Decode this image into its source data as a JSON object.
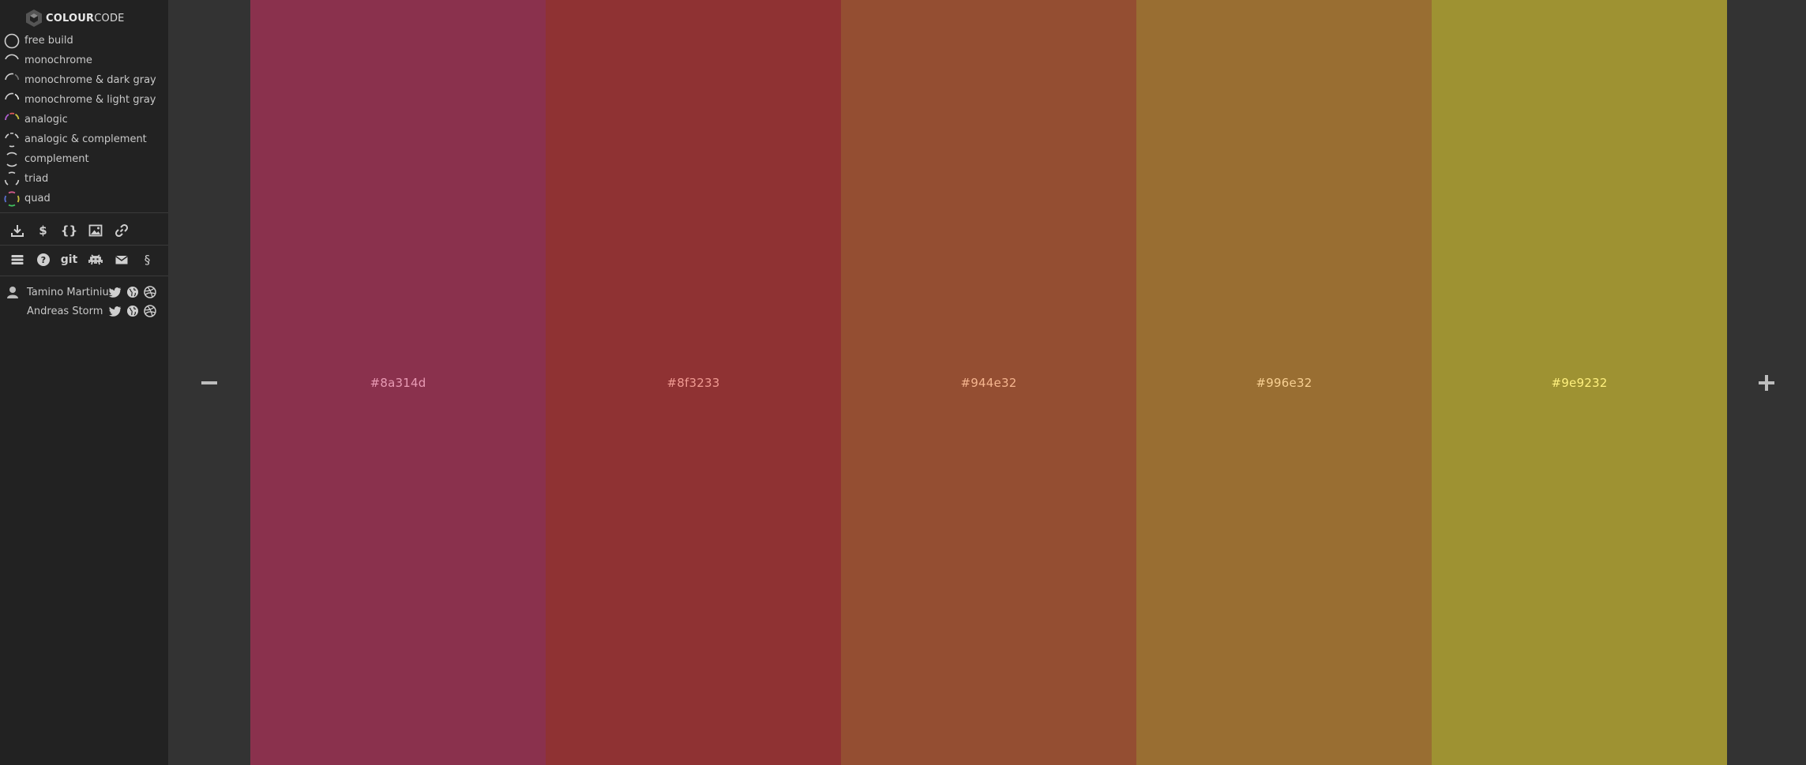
{
  "app": {
    "brand_bold": "COLOUR",
    "brand_light": "CODE"
  },
  "modes": [
    {
      "label": "free build",
      "icon": "ring-free-build-icon"
    },
    {
      "label": "monochrome",
      "icon": "ring-monochrome-icon"
    },
    {
      "label": "monochrome & dark gray",
      "icon": "ring-monochrome-dark-gray-icon"
    },
    {
      "label": "monochrome & light gray",
      "icon": "ring-monochrome-light-gray-icon"
    },
    {
      "label": "analogic",
      "icon": "ring-analogic-icon"
    },
    {
      "label": "analogic & complement",
      "icon": "ring-analogic-complement-icon"
    },
    {
      "label": "complement",
      "icon": "ring-complement-icon"
    },
    {
      "label": "triad",
      "icon": "ring-triad-icon"
    },
    {
      "label": "quad",
      "icon": "ring-quad-icon"
    }
  ],
  "tools_row1": [
    {
      "name": "download-icon"
    },
    {
      "name": "dollar-icon",
      "text": "$"
    },
    {
      "name": "code-braces-icon",
      "text": "{}"
    },
    {
      "name": "image-icon"
    },
    {
      "name": "link-icon"
    }
  ],
  "tools_row2": [
    {
      "name": "menu-stack-icon"
    },
    {
      "name": "help-icon"
    },
    {
      "name": "git-icon",
      "text": "git"
    },
    {
      "name": "invader-icon"
    },
    {
      "name": "mail-icon"
    },
    {
      "name": "section-icon",
      "text": "§"
    }
  ],
  "credits": [
    {
      "name": "Tamino Martinius"
    },
    {
      "name": "Andreas Storm"
    }
  ],
  "palette": [
    {
      "hex": "#8a314d",
      "bg": "#8a314d",
      "text_color": "#e89ab4"
    },
    {
      "hex": "#8f3233",
      "bg": "#8f3233",
      "text_color": "#f09a92"
    },
    {
      "hex": "#944e32",
      "bg": "#944e32",
      "text_color": "#f4b48e"
    },
    {
      "hex": "#996e32",
      "bg": "#996e32",
      "text_color": "#f8d092"
    },
    {
      "hex": "#9e9232",
      "bg": "#9e9232",
      "text_color": "#fff07e"
    }
  ],
  "colors": {
    "sidebar_bg": "#222222",
    "page_bg": "#333333",
    "icon": "#cfcfcf"
  }
}
